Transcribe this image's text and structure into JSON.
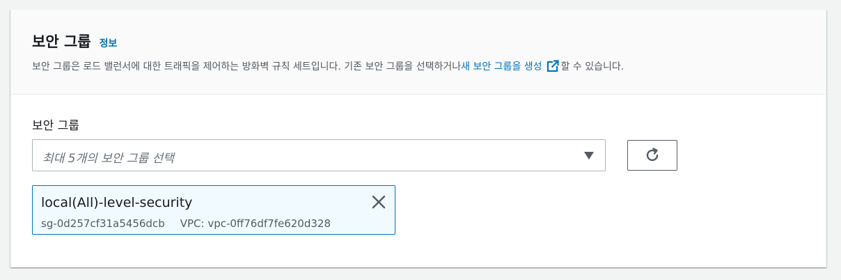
{
  "section": {
    "title": "보안 그룹",
    "info_link": "정보",
    "description_prefix": "보안 그룹은 로드 밸런서에 대한 트래픽을 제어하는 방화벽 규칙 세트입니다. 기존 보안 그룹을 선택하거나 ",
    "description_link": "새 보안 그룹을 생성",
    "description_suffix": "할 수 있습니다."
  },
  "field": {
    "label": "보안 그룹",
    "select_placeholder": "최대 5개의 보안 그룹 선택",
    "refresh_icon": "refresh-icon"
  },
  "selected_groups": [
    {
      "name": "local(All)-level-security",
      "id": "sg-0d257cf31a5456dcb",
      "vpc": "VPC: vpc-0ff76df7fe620d328"
    }
  ],
  "colors": {
    "link": "#0073bb",
    "token_bg": "#f1faff",
    "token_border": "#0073bb",
    "header_bg": "#fafafa",
    "page_bg": "#f2f3f3"
  }
}
